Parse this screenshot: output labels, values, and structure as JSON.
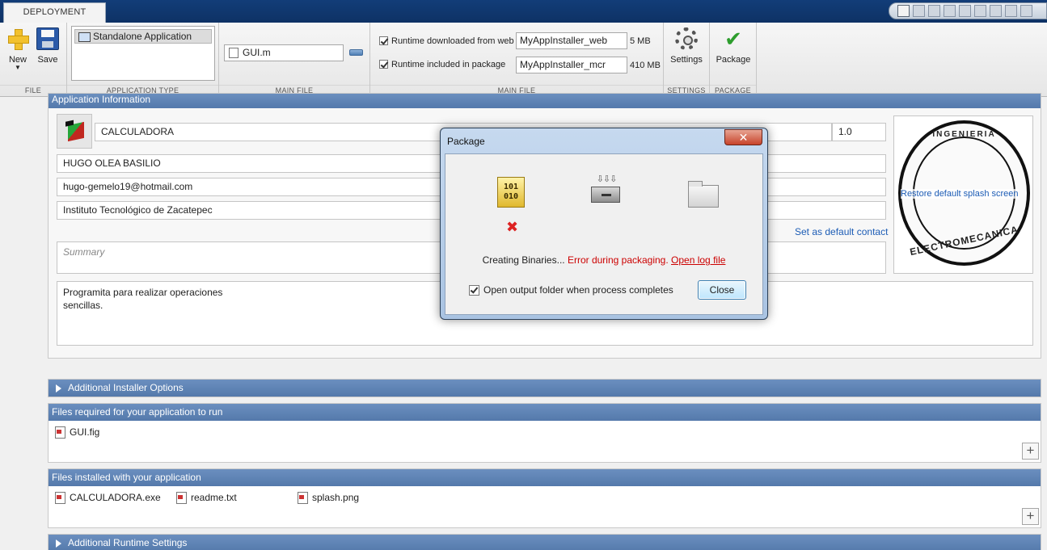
{
  "tab": {
    "label": "DEPLOYMENT"
  },
  "toolstrip": {
    "file": {
      "new_label": "New",
      "save_label": "Save",
      "section": "FILE"
    },
    "app_type": {
      "selected": "Standalone Application",
      "section": "APPLICATION TYPE"
    },
    "main_file": {
      "value": "GUI.m",
      "section": "MAIN FILE"
    },
    "packaging": {
      "web_label": "Runtime downloaded from web",
      "web_value": "MyAppInstaller_web",
      "web_size": "5 MB",
      "mcr_label": "Runtime included in package",
      "mcr_value": "MyAppInstaller_mcr",
      "mcr_size": "410 MB",
      "section": "MAIN FILE"
    },
    "settings": {
      "label": "Settings",
      "section": "SETTINGS"
    },
    "package": {
      "label": "Package",
      "section": "PACKAGE"
    }
  },
  "app_info": {
    "header": "Application Information",
    "name": "CALCULADORA",
    "version": "1.0",
    "author": "HUGO OLEA BASILIO",
    "email": "hugo-gemelo19@hotmail.com",
    "company": "Instituto Tecnológico de Zacatepec",
    "default_contact": "Set as default contact",
    "restore_splash": "Restore default splash screen",
    "summary_placeholder": "Summary",
    "description": "Programita para realizar operaciones\nsencillas.",
    "logo_top": "INGENIERIA",
    "logo_bottom": "ELECTROMECANICA"
  },
  "sections": {
    "installer_options": "Additional Installer Options",
    "required_files": "Files required for your application to run",
    "installed_files": "Files installed with your application",
    "runtime_settings": "Additional Runtime Settings"
  },
  "required_files": [
    "GUI.fig"
  ],
  "installed_files": [
    "CALCULADORA.exe",
    "readme.txt",
    "splash.png"
  ],
  "dialog": {
    "title": "Package",
    "binary_icon_text": "101\n010",
    "status": "Creating Binaries...",
    "error": "Error during packaging.",
    "log_link": "Open log file",
    "checkbox_label": "Open output folder when process completes",
    "close_label": "Close"
  }
}
